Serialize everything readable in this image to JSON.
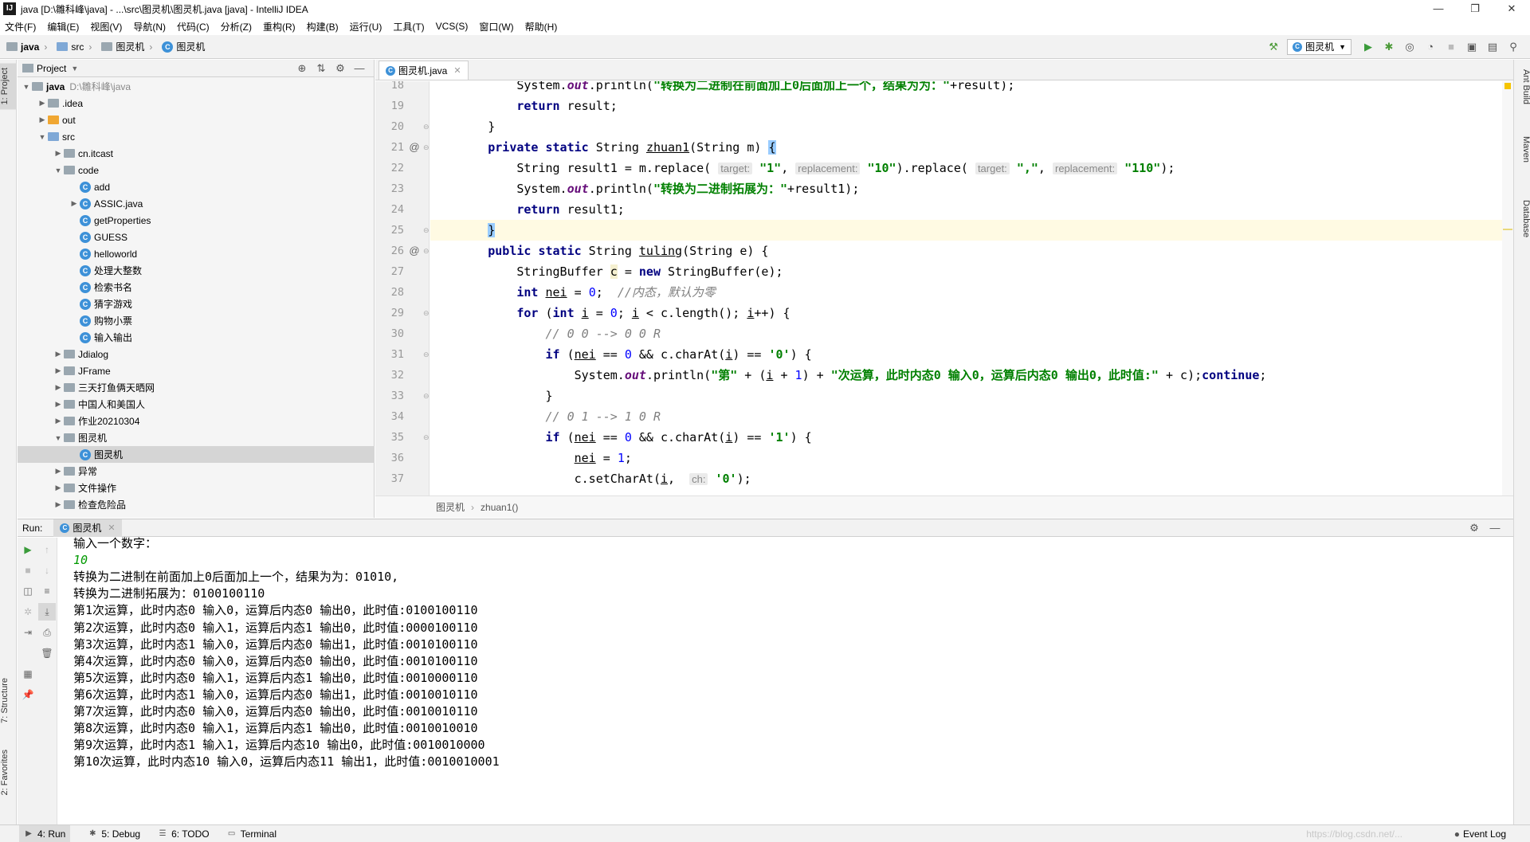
{
  "window": {
    "title": "java [D:\\雛科峰\\java] - ...\\src\\图灵机\\图灵机.java [java] - IntelliJ IDEA",
    "controls": [
      "—",
      "❐",
      "✕"
    ]
  },
  "menu": [
    "文件(F)",
    "编辑(E)",
    "视图(V)",
    "导航(N)",
    "代码(C)",
    "分析(Z)",
    "重构(R)",
    "构建(B)",
    "运行(U)",
    "工具(T)",
    "VCS(S)",
    "窗口(W)",
    "帮助(H)"
  ],
  "navbar": {
    "crumbs": [
      "java",
      "src",
      "图灵机",
      "图灵机"
    ],
    "run_config": "图灵机"
  },
  "left_stripe": {
    "project": "1: Project",
    "structure": "7: Structure",
    "favorites": "2: Favorites"
  },
  "right_stripe": {
    "ant": "Ant Build",
    "maven": "Maven",
    "database": "Database"
  },
  "project_panel": {
    "title": "Project",
    "tree": [
      {
        "label": "java",
        "path": "D:\\雛科峰\\java",
        "depth": 0,
        "expanded": true,
        "icon": "folder-icon",
        "bold": true
      },
      {
        "label": ".idea",
        "depth": 1,
        "expanded": false,
        "icon": "folder-icon"
      },
      {
        "label": "out",
        "depth": 1,
        "expanded": false,
        "icon": "folder-orange-icon"
      },
      {
        "label": "src",
        "depth": 1,
        "expanded": true,
        "icon": "folder-blue-icon"
      },
      {
        "label": "cn.itcast",
        "depth": 2,
        "expanded": false,
        "icon": "package-icon"
      },
      {
        "label": "code",
        "depth": 2,
        "expanded": true,
        "icon": "package-icon"
      },
      {
        "label": "add",
        "depth": 3,
        "icon": "class-icon"
      },
      {
        "label": "ASSIC.java",
        "depth": 3,
        "expanded": false,
        "icon": "class-icon"
      },
      {
        "label": "getProperties",
        "depth": 3,
        "icon": "class-icon"
      },
      {
        "label": "GUESS",
        "depth": 3,
        "icon": "class-icon"
      },
      {
        "label": "helloworld",
        "depth": 3,
        "icon": "class-icon"
      },
      {
        "label": "处理大整数",
        "depth": 3,
        "icon": "class-icon"
      },
      {
        "label": "检索书名",
        "depth": 3,
        "icon": "class-icon"
      },
      {
        "label": "猜字游戏",
        "depth": 3,
        "icon": "class-icon"
      },
      {
        "label": "购物小票",
        "depth": 3,
        "icon": "class-icon"
      },
      {
        "label": "输入输出",
        "depth": 3,
        "icon": "class-icon"
      },
      {
        "label": "Jdialog",
        "depth": 2,
        "expanded": false,
        "icon": "package-icon"
      },
      {
        "label": "JFrame",
        "depth": 2,
        "expanded": false,
        "icon": "package-icon"
      },
      {
        "label": "三天打鱼俩天晒网",
        "depth": 2,
        "expanded": false,
        "icon": "package-icon"
      },
      {
        "label": "中国人和美国人",
        "depth": 2,
        "expanded": false,
        "icon": "package-icon"
      },
      {
        "label": "作业20210304",
        "depth": 2,
        "expanded": false,
        "icon": "package-icon"
      },
      {
        "label": "图灵机",
        "depth": 2,
        "expanded": true,
        "icon": "package-icon"
      },
      {
        "label": "图灵机",
        "depth": 3,
        "icon": "class-icon",
        "selected": true
      },
      {
        "label": "异常",
        "depth": 2,
        "expanded": false,
        "icon": "package-icon"
      },
      {
        "label": "文件操作",
        "depth": 2,
        "expanded": false,
        "icon": "package-icon"
      },
      {
        "label": "检查危险品",
        "depth": 2,
        "expanded": false,
        "icon": "package-icon"
      }
    ]
  },
  "editor": {
    "tab": "图灵机.java",
    "breadcrumb": [
      "图灵机",
      "zhuan1()"
    ],
    "lines": [
      {
        "n": "18",
        "mark": "",
        "fold": "",
        "html": "            System.<span class=\"fld\">out</span>.println(<span class=\"str\">\"转换为二进制在前面加上0后面加上一个，结果为为：\"</span>+result);"
      },
      {
        "n": "19",
        "mark": "",
        "fold": "",
        "html": "            <span class=\"kw\">return</span> result;"
      },
      {
        "n": "20",
        "mark": "",
        "fold": "⊖",
        "html": "        }"
      },
      {
        "n": "21",
        "mark": "@",
        "fold": "⊖",
        "html": "        <span class=\"kw\">private static</span> String <span class=\"uline\">zhuan1</span>(String m) <span class=\"bracehl\">{</span>"
      },
      {
        "n": "22",
        "mark": "",
        "fold": "",
        "html": "            String result1 = m.replace( <span class=\"hint\">target:</span> <span class=\"str\">\"1\"</span>, <span class=\"hint\">replacement:</span> <span class=\"str\">\"10\"</span>).replace( <span class=\"hint\">target:</span> <span class=\"str\">\",\"</span>, <span class=\"hint\">replacement:</span> <span class=\"str\">\"110\"</span>);"
      },
      {
        "n": "23",
        "mark": "",
        "fold": "",
        "html": "            System.<span class=\"fld\">out</span>.println(<span class=\"str\">\"转换为二进制拓展为：\"</span>+result1);"
      },
      {
        "n": "24",
        "mark": "",
        "fold": "",
        "html": "            <span class=\"kw\">return</span> result1;"
      },
      {
        "n": "25",
        "mark": "",
        "fold": "⊖",
        "html": "        <span class=\"bracehl\">}</span>",
        "highlight": true
      },
      {
        "n": "26",
        "mark": "@",
        "fold": "⊖",
        "html": "        <span class=\"kw\">public static</span> String <span class=\"uline\">tuling</span>(String e) {"
      },
      {
        "n": "27",
        "mark": "",
        "fold": "",
        "html": "            StringBuffer <span style=\"background:#f5f0d0\">c</span> = <span class=\"kw\">new</span> StringBuffer(e);"
      },
      {
        "n": "28",
        "mark": "",
        "fold": "",
        "html": "            <span class=\"kw\">int</span> <span class=\"uline\">nei</span> = <span class=\"num\">0</span>;  <span class=\"cmt\">//内态，默认为零</span>"
      },
      {
        "n": "29",
        "mark": "",
        "fold": "⊖",
        "html": "            <span class=\"kw\">for</span> (<span class=\"kw\">int</span> <span class=\"uline\">i</span> = <span class=\"num\">0</span>; <span class=\"uline\">i</span> &lt; c.length(); <span class=\"uline\">i</span>++) {"
      },
      {
        "n": "30",
        "mark": "",
        "fold": "",
        "html": "                <span class=\"cmt\">// 0 0 --&gt; 0 0 R</span>"
      },
      {
        "n": "31",
        "mark": "",
        "fold": "⊖",
        "html": "                <span class=\"kw\">if</span> (<span class=\"uline\">nei</span> == <span class=\"num\">0</span> &amp;&amp; c.charAt(<span class=\"uline\">i</span>) == <span class=\"str\">'0'</span>) {"
      },
      {
        "n": "32",
        "mark": "",
        "fold": "",
        "html": "                    System.<span class=\"fld\">out</span>.println(<span class=\"str\">\"第\"</span> + (<span class=\"uline\">i</span> + <span class=\"num\">1</span>) + <span class=\"str\">\"次运算，此时内态0 输入0，运算后内态0 输出0，此时值:\"</span> + c);<span class=\"kw\">continue</span>;"
      },
      {
        "n": "33",
        "mark": "",
        "fold": "⊖",
        "html": "                }"
      },
      {
        "n": "34",
        "mark": "",
        "fold": "",
        "html": "                <span class=\"cmt\">// 0 1 --&gt; 1 0 R</span>"
      },
      {
        "n": "35",
        "mark": "",
        "fold": "⊖",
        "html": "                <span class=\"kw\">if</span> (<span class=\"uline\">nei</span> == <span class=\"num\">0</span> &amp;&amp; c.charAt(<span class=\"uline\">i</span>) == <span class=\"str\">'1'</span>) {"
      },
      {
        "n": "36",
        "mark": "",
        "fold": "",
        "html": "                    <span class=\"uline\">nei</span> = <span class=\"num\">1</span>;"
      },
      {
        "n": "37",
        "mark": "",
        "fold": "",
        "html": "                    c.setCharAt(<span class=\"uline\">i</span>,  <span class=\"hint\">ch:</span> <span class=\"str\">'0'</span>);"
      }
    ]
  },
  "run_panel": {
    "label": "Run:",
    "tab": "图灵机",
    "output": [
      {
        "text": "输入一个数字：",
        "input": false
      },
      {
        "text": "10",
        "input": true
      },
      {
        "text": "转换为二进制在前面加上0后面加上一个，结果为为：01010,",
        "input": false
      },
      {
        "text": "转换为二进制拓展为：0100100110",
        "input": false
      },
      {
        "text": "第1次运算，此时内态0 输入0，运算后内态0 输出0，此时值:0100100110",
        "input": false
      },
      {
        "text": "第2次运算，此时内态0 输入1，运算后内态1 输出0，此时值:0000100110",
        "input": false
      },
      {
        "text": "第3次运算，此时内态1 输入0，运算后内态0 输出1，此时值:0010100110",
        "input": false
      },
      {
        "text": "第4次运算，此时内态0 输入0，运算后内态0 输出0，此时值:0010100110",
        "input": false
      },
      {
        "text": "第5次运算，此时内态0 输入1，运算后内态1 输出0，此时值:0010000110",
        "input": false
      },
      {
        "text": "第6次运算，此时内态1 输入0，运算后内态0 输出1，此时值:0010010110",
        "input": false
      },
      {
        "text": "第7次运算，此时内态0 输入0，运算后内态0 输出0，此时值:0010010110",
        "input": false
      },
      {
        "text": "第8次运算，此时内态0 输入1，运算后内态1 输出0，此时值:0010010010",
        "input": false
      },
      {
        "text": "第9次运算，此时内态1 输入1，运算后内态10 输出0，此时值:0010010000",
        "input": false
      },
      {
        "text": "第10次运算，此时内态10 输入0，运算后内态11 输出1，此时值:0010010001",
        "input": false
      }
    ]
  },
  "bottom_bar": {
    "tabs": [
      {
        "label": "4: Run",
        "icon": "run-icon",
        "active": true
      },
      {
        "label": "5: Debug",
        "icon": "debug-icon",
        "active": false
      },
      {
        "label": "6: TODO",
        "icon": "todo-icon",
        "active": false
      },
      {
        "label": "Terminal",
        "icon": "terminal-icon",
        "active": false
      }
    ],
    "event_log": "Event Log",
    "watermark": "https://blog.csdn.net/..."
  },
  "colors": {
    "keyword": "#000080",
    "string": "#008000",
    "comment": "#808080",
    "number": "#0000ff",
    "field": "#660e7a",
    "console_input": "#009900",
    "selection": "#d5d5d5",
    "caret_line": "#fffae3"
  }
}
